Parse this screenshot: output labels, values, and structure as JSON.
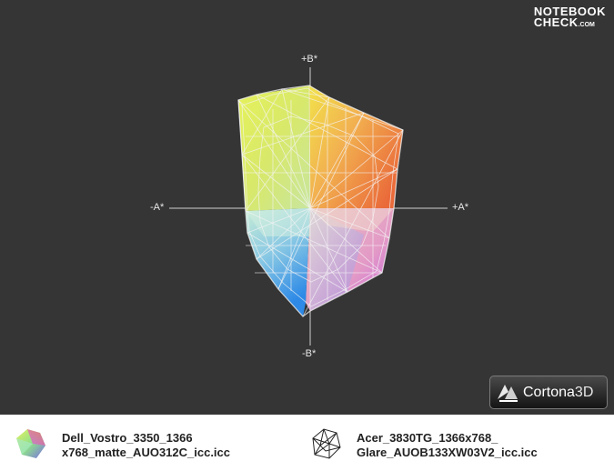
{
  "viewer": {
    "background": "#353535",
    "axes": {
      "b_plus": "+B*",
      "b_minus": "-B*",
      "a_minus": "-A*",
      "a_plus": "+A*"
    },
    "logo": {
      "line1": "NOTEBOOK",
      "line2": "CHECK",
      "line3": ".COM"
    },
    "cortona": {
      "brand": "Cortona",
      "suffix": "3D",
      "icon": "cortona-logo-icon"
    }
  },
  "legend": {
    "items": [
      {
        "line1": "Dell_Vostro_3350_1366",
        "line2": "x768_matte_AUO312C_icc.icc",
        "icon": "solid-gamut-icon"
      },
      {
        "line1": "Acer_3830TG_1366x768_",
        "line2": "Glare_AUOB133XW03V2_icc.icc",
        "icon": "wireframe-gamut-icon"
      }
    ]
  }
}
